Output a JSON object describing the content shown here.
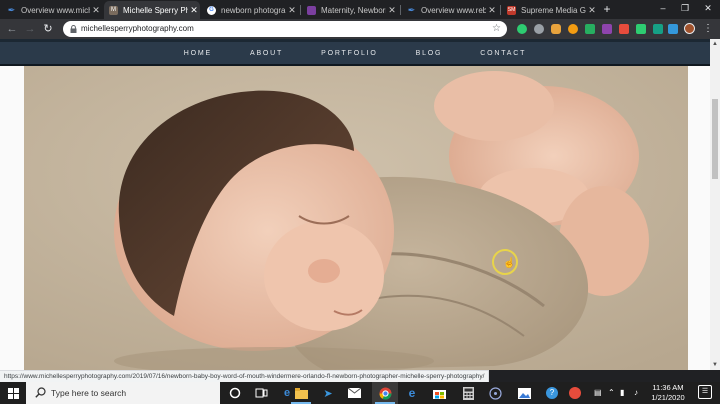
{
  "browser": {
    "tabs": [
      {
        "title": "Overview www.mich",
        "favicon": "feather-icon",
        "color": "#4a8de0",
        "active": false
      },
      {
        "title": "Michelle Sperry Phot",
        "favicon": "site-icon",
        "color": "#7a6b5d",
        "active": true
      },
      {
        "title": "newborn photograph",
        "favicon": "google-icon",
        "color": "#ffffff",
        "active": false
      },
      {
        "title": "Maternity, Newborn",
        "favicon": "site-icon",
        "color": "#7b3fa0",
        "active": false
      },
      {
        "title": "Overview www.rebe",
        "favicon": "feather-icon",
        "color": "#4a8de0",
        "active": false
      },
      {
        "title": "Supreme Media Gro",
        "favicon": "sm-icon",
        "color": "#c0392b",
        "active": false
      }
    ],
    "address": {
      "url": "michellesperryphotography.com"
    },
    "window_controls": {
      "minimize": "–",
      "maximize": "❐",
      "close": "✕"
    },
    "new_tab_glyph": "+",
    "status_url": "https://www.michellesperryphotography.com/2019/07/16/newborn-baby-boy-word-of-mouth-windermere-orlando-fl-newborn-photographer-michelle-sperry-photography/"
  },
  "site": {
    "nav": [
      {
        "label": "HOME"
      },
      {
        "label": "ABOUT"
      },
      {
        "label": "PORTFOLIO"
      },
      {
        "label": "BLOG"
      },
      {
        "label": "CONTACT"
      }
    ],
    "colors": {
      "nav_bg": "#2b3a4a",
      "nav_text": "#e6e9ec"
    }
  },
  "taskbar": {
    "search_placeholder": "Type here to search",
    "time": "11:36 AM",
    "date": "1/21/2020",
    "accent": "#76b9ed"
  }
}
